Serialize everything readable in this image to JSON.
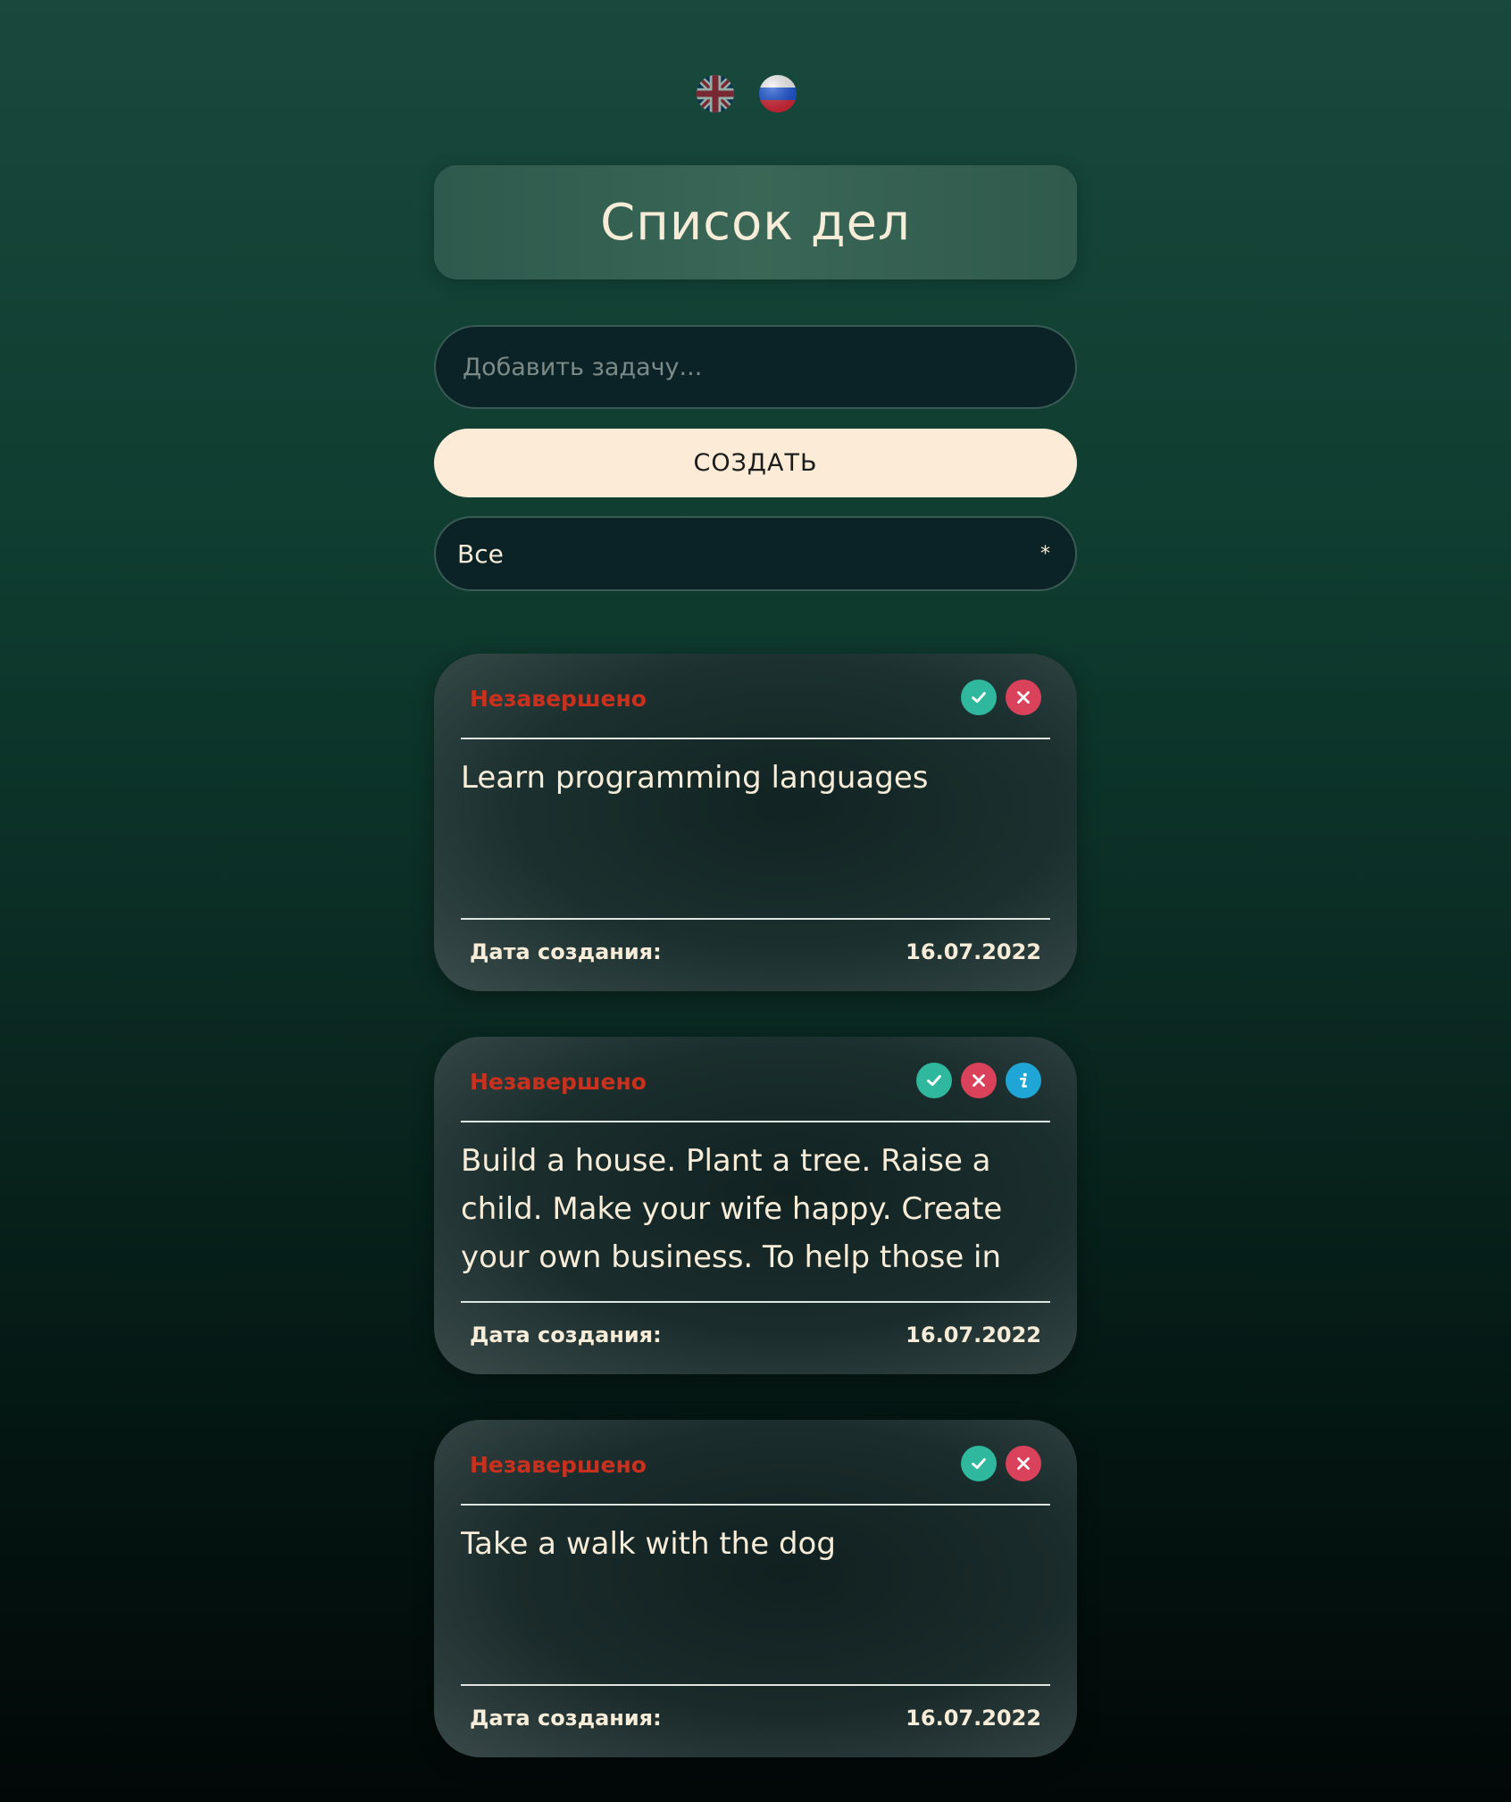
{
  "languages": [
    {
      "code": "en",
      "icon": "uk-flag-icon"
    },
    {
      "code": "ru",
      "icon": "russia-flag-icon"
    }
  ],
  "header": {
    "title": "Список дел"
  },
  "new_task": {
    "placeholder": "Добавить задачу...",
    "value": ""
  },
  "create_button": {
    "label": "СОЗДАТЬ"
  },
  "filter": {
    "selected": "Все",
    "arrow": "*"
  },
  "colors": {
    "status_incomplete": "#c9301e",
    "complete_button": "#2fb89d",
    "delete_button": "#d9425a",
    "info_button": "#1fa6d6",
    "create_button_bg": "#fbebd7",
    "text": "#f6ecd8"
  },
  "tasks": [
    {
      "status": "Незавершено",
      "text": "Learn programming languages",
      "date_label": "Дата создания:",
      "date": "16.07.2022",
      "has_info": false
    },
    {
      "status": "Незавершено",
      "text": "Build a house. Plant a tree. Raise a child. Make your wife happy. Create your own business. To help those in",
      "date_label": "Дата создания:",
      "date": "16.07.2022",
      "has_info": true
    },
    {
      "status": "Незавершено",
      "text": "Take a walk with the dog",
      "date_label": "Дата создания:",
      "date": "16.07.2022",
      "has_info": false
    }
  ]
}
